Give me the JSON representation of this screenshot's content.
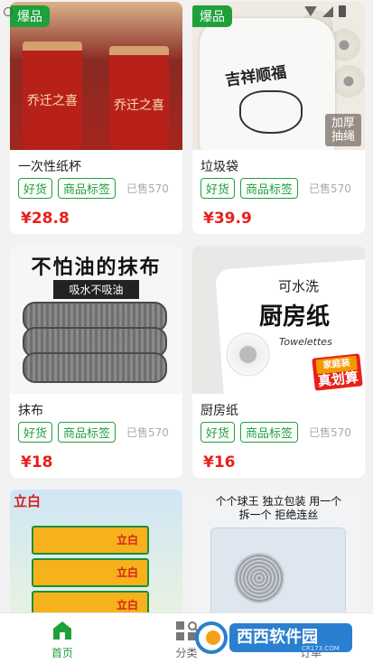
{
  "products": [
    {
      "name": "一次性纸杯",
      "price": "¥28.8",
      "hot_badge": "爆品",
      "tags": [
        "好货",
        "商品标签"
      ],
      "sold": "已售570",
      "image_text": "乔迁之喜"
    },
    {
      "name": "垃圾袋",
      "price": "¥39.9",
      "hot_badge": "爆品",
      "tags": [
        "好货",
        "商品标签"
      ],
      "sold": "已售570",
      "image_text": "吉祥顺福",
      "image_badge": "加厚 抽绳"
    },
    {
      "name": "抹布",
      "price": "¥18",
      "tags": [
        "好货",
        "商品标签"
      ],
      "sold": "已售570",
      "image_title": "不怕油的抹布",
      "image_sub": "吸水不吸油"
    },
    {
      "name": "厨房纸",
      "price": "¥16",
      "tags": [
        "好货",
        "商品标签"
      ],
      "sold": "已售570",
      "image_line1": "可水洗",
      "image_line2": "厨房纸",
      "image_line3": "Towelettes",
      "image_deal_top": "家庭装",
      "image_deal": "真划算"
    },
    {
      "image_brand": "立白",
      "image_box_text": "立白"
    },
    {
      "image_header": "个个球王 独立包装 用一个拆一个 拒绝连丝"
    }
  ],
  "tabbar": {
    "items": [
      {
        "label": "首页",
        "icon": "home-icon"
      },
      {
        "label": "分类",
        "icon": "category-icon"
      },
      {
        "label": "订单",
        "icon": "order-icon"
      }
    ]
  },
  "watermark": {
    "main": "西西软件园",
    "sub": "CR173.COM"
  },
  "colors": {
    "accent": "#1fa03a",
    "price": "#e8201a",
    "background": "#f2f2f2"
  }
}
